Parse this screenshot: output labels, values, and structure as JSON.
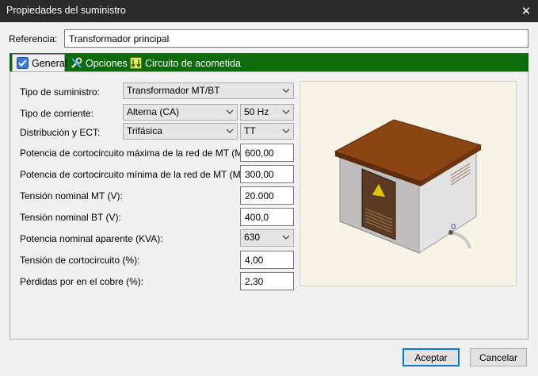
{
  "window": {
    "title": "Propiedades del suministro",
    "close_glyph": "✕"
  },
  "reference": {
    "label": "Referencia:",
    "value": "Transformador principal"
  },
  "tabs": [
    {
      "label": "General",
      "icon": "checkbox-icon",
      "active": true
    },
    {
      "label": "Opciones",
      "icon": "tools-icon",
      "active": false
    },
    {
      "label": "Circuito de acometida",
      "icon": "circuit-icon",
      "active": false
    }
  ],
  "form": {
    "supply_type": {
      "label": "Tipo de suministro:",
      "value": "Transformador MT/BT"
    },
    "current_type": {
      "label": "Tipo de corriente:",
      "value": "Alterna (CA)",
      "frequency": "50 Hz"
    },
    "distribution": {
      "label": "Distribución y ECT:",
      "value": "Trifásica",
      "ect": "TT"
    },
    "sc_power_max": {
      "label": "Potencia de cortocircuito máxima de la red de MT (MVA):",
      "value": "600,00"
    },
    "sc_power_min": {
      "label": "Potencia de cortocircuito mínima de la red de MT (MVA):",
      "value": "300,00"
    },
    "voltage_mt": {
      "label": "Tensión nominal MT (V):",
      "value": "20.000"
    },
    "voltage_bt": {
      "label": "Tensión nominal BT (V):",
      "value": "400,0"
    },
    "apparent_power": {
      "label": "Potencia nominal aparente (KVA):",
      "value": "630"
    },
    "sc_voltage": {
      "label": "Tensión de cortocircuito (%):",
      "value": "4,00"
    },
    "copper_losses": {
      "label": "Pérdidas por en el cobre (%):",
      "value": "2,30"
    }
  },
  "preview": {
    "label": "0"
  },
  "buttons": {
    "accept": "Aceptar",
    "cancel": "Cancelar"
  },
  "colors": {
    "tabbar": "#0b6b0b",
    "roof": "#8b4513",
    "accent": "#0078d7"
  }
}
